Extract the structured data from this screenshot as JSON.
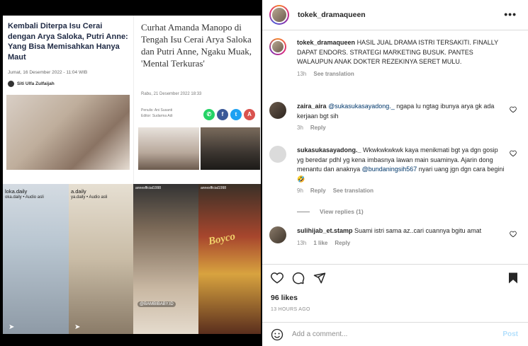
{
  "post_image": {
    "article1": {
      "title": "Kembali Diterpa Isu Cerai dengan Arya Saloka, Putri Anne: Yang Bisa Memisahkan Hanya Maut",
      "date": "Jumat, 16 Desember 2022 - 11:04 WIB",
      "author": "Siti Ulfa Zulfaijah"
    },
    "article2": {
      "title": "Curhat Amanda Manopo di Tengah Isu Cerai Arya Saloka dan Putri Anne, Ngaku Muak, 'Mental Terkuras'",
      "date": "Rabu, 21 Desember 2022 18:33",
      "writer": "Penulis: Ani Susanti",
      "editor": "Editor: Sudarma Adi",
      "share_icons": [
        "whatsapp-icon",
        "facebook-icon",
        "twitter-icon",
        "font-size-icon"
      ]
    },
    "tiles": [
      {
        "account": "loka.daily",
        "sub": "oka.daily • Audio asli"
      },
      {
        "account": "a.daily",
        "sub": "ya.daily • Audio asli"
      },
      {
        "top": "annesfficial1998",
        "watermark": "@BAMBIBABY.ID"
      },
      {
        "top": "annesfficial1998",
        "brand": "Boyco"
      }
    ]
  },
  "header": {
    "username": "tokek_dramaqueen",
    "more_icon": "more-options-icon"
  },
  "caption": {
    "username": "tokek_dramaqueen",
    "text": "HASIL JUAL DRAMA ISTRI TERSAKITI. FINALLY DAPAT ENDORS. STRATEGI MARKETING BUSUK. PANTES WALAUPUN ANAK DOKTER REZEKINYA SERET MULU.",
    "time": "13h",
    "see_translation": "See translation"
  },
  "comments": [
    {
      "username": "zaira_aira",
      "mention": "@sukasukasayadong._",
      "text": " ngapa lu ngtag ibunya arya gk ada kerjaan bgt sih",
      "time": "3h",
      "reply": "Reply"
    },
    {
      "username": "sukasukasayadong._",
      "text": " Wkwkwkwkwk kaya menikmati bgt ya dgn gosip yg beredar pdhl yg kena imbasnya lawan main suaminya. Ajarin dong menantu dan anaknya ",
      "mention": "@bundaningsih567",
      "text2": " nyari uang jgn dgn cara begini🤣",
      "time": "9h",
      "reply": "Reply",
      "see_translation": "See translation"
    },
    {
      "username": "sulihijab_et.stamp",
      "text": " Suami istri sama az..cari cuannya bgitu amat",
      "time": "13h",
      "likes": "1 like",
      "reply": "Reply"
    }
  ],
  "view_replies": "View replies (1)",
  "likes": "96 likes",
  "time_ago": "13 HOURS AGO",
  "add_comment": {
    "placeholder": "Add a comment...",
    "post_label": "Post"
  },
  "colors": {
    "link": "#00376b",
    "muted": "#8e8e8e",
    "post_disabled": "#b2dffc"
  }
}
